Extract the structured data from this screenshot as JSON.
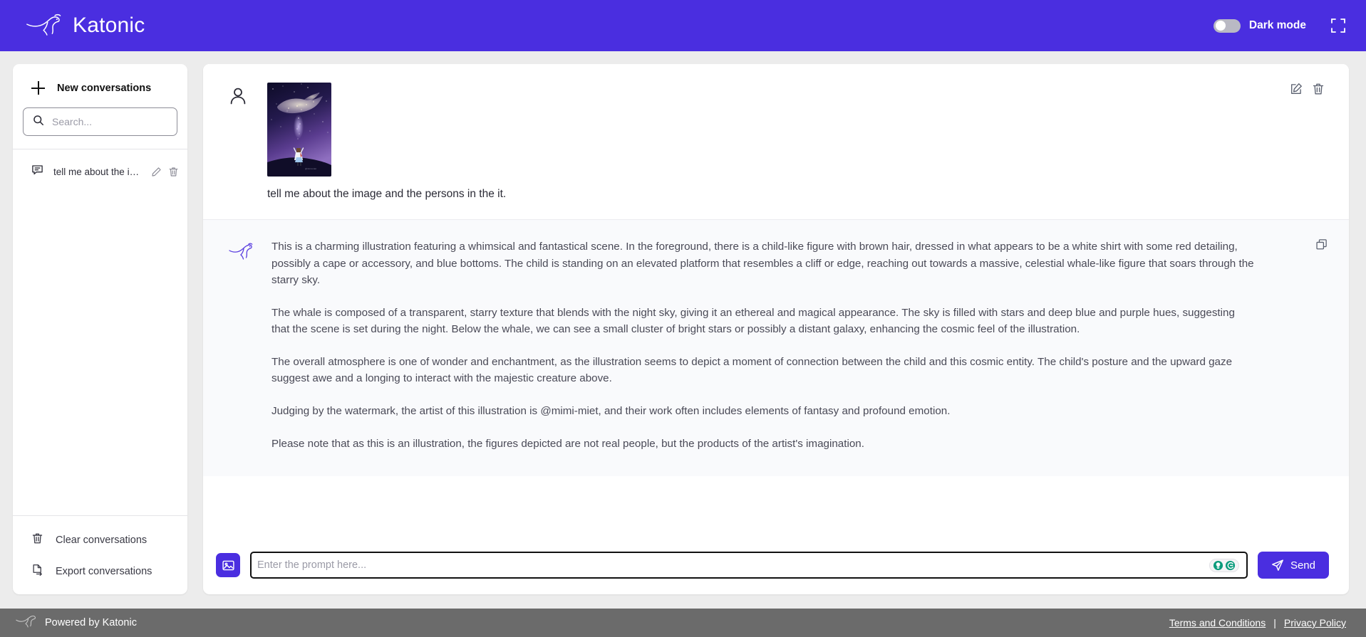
{
  "header": {
    "brand_name": "Katonic",
    "brand_logo_icon": "kangaroo-logo-icon",
    "dark_mode_label": "Dark mode",
    "dark_mode_enabled": false,
    "expand_icon": "fullscreen-expand-icon",
    "background_color": "#4a2ee0"
  },
  "sidebar": {
    "new_conversation_label": "New conversations",
    "search": {
      "placeholder": "Search...",
      "value": ""
    },
    "conversations": [
      {
        "title": "tell me about the image…",
        "icon": "chat-bubble-icon"
      }
    ],
    "footer_actions": [
      {
        "label": "Clear conversations",
        "icon": "trash-icon"
      },
      {
        "label": "Export conversations",
        "icon": "file-export-icon"
      }
    ]
  },
  "conversation": {
    "user_message": {
      "avatar_icon": "user-avatar-icon",
      "attachment_alt": "starry whale illustration with child",
      "text": "tell me about the image and the persons in the it.",
      "actions": [
        {
          "icon": "edit-icon",
          "label": "Edit"
        },
        {
          "icon": "trash-icon",
          "label": "Delete"
        }
      ]
    },
    "bot_message": {
      "avatar_icon": "katonic-kangaroo-icon",
      "copy_icon": "copy-icon",
      "paragraphs": [
        "This is a charming illustration featuring a whimsical and fantastical scene. In the foreground, there is a child-like figure with brown hair, dressed in what appears to be a white shirt with some red detailing, possibly a cape or accessory, and blue bottoms. The child is standing on an elevated platform that resembles a cliff or edge, reaching out towards a massive, celestial whale-like figure that soars through the starry sky.",
        "The whale is composed of a transparent, starry texture that blends with the night sky, giving it an ethereal and magical appearance. The sky is filled with stars and deep blue and purple hues, suggesting that the scene is set during the night. Below the whale, we can see a small cluster of bright stars or possibly a distant galaxy, enhancing the cosmic feel of the illustration.",
        "The overall atmosphere is one of wonder and enchantment, as the illustration seems to depict a moment of connection between the child and this cosmic entity. The child's posture and the upward gaze suggest awe and a longing to interact with the majestic creature above.",
        "Judging by the watermark, the artist of this illustration is @mimi-miet, and their work often includes elements of fantasy and profound emotion.",
        "Please note that as this is an illustration, the figures depicted are not real people, but the products of the artist's imagination."
      ]
    }
  },
  "composer": {
    "image_upload_icon": "image-upload-icon",
    "prompt": {
      "placeholder": "Enter the prompt here...",
      "value": ""
    },
    "assistant_badges": [
      {
        "icon": "lightbulb-icon",
        "color": "#0a9b7c"
      },
      {
        "icon": "grammarly-g-icon",
        "color": "#0a9b7c"
      }
    ],
    "send_label": "Send",
    "send_icon": "paper-plane-icon"
  },
  "footer": {
    "powered_by": "Powered by Katonic",
    "logo_icon": "kangaroo-logo-icon",
    "separator": "|",
    "links": [
      {
        "label": "Terms and Conditions"
      },
      {
        "label": "Privacy Policy"
      }
    ]
  }
}
